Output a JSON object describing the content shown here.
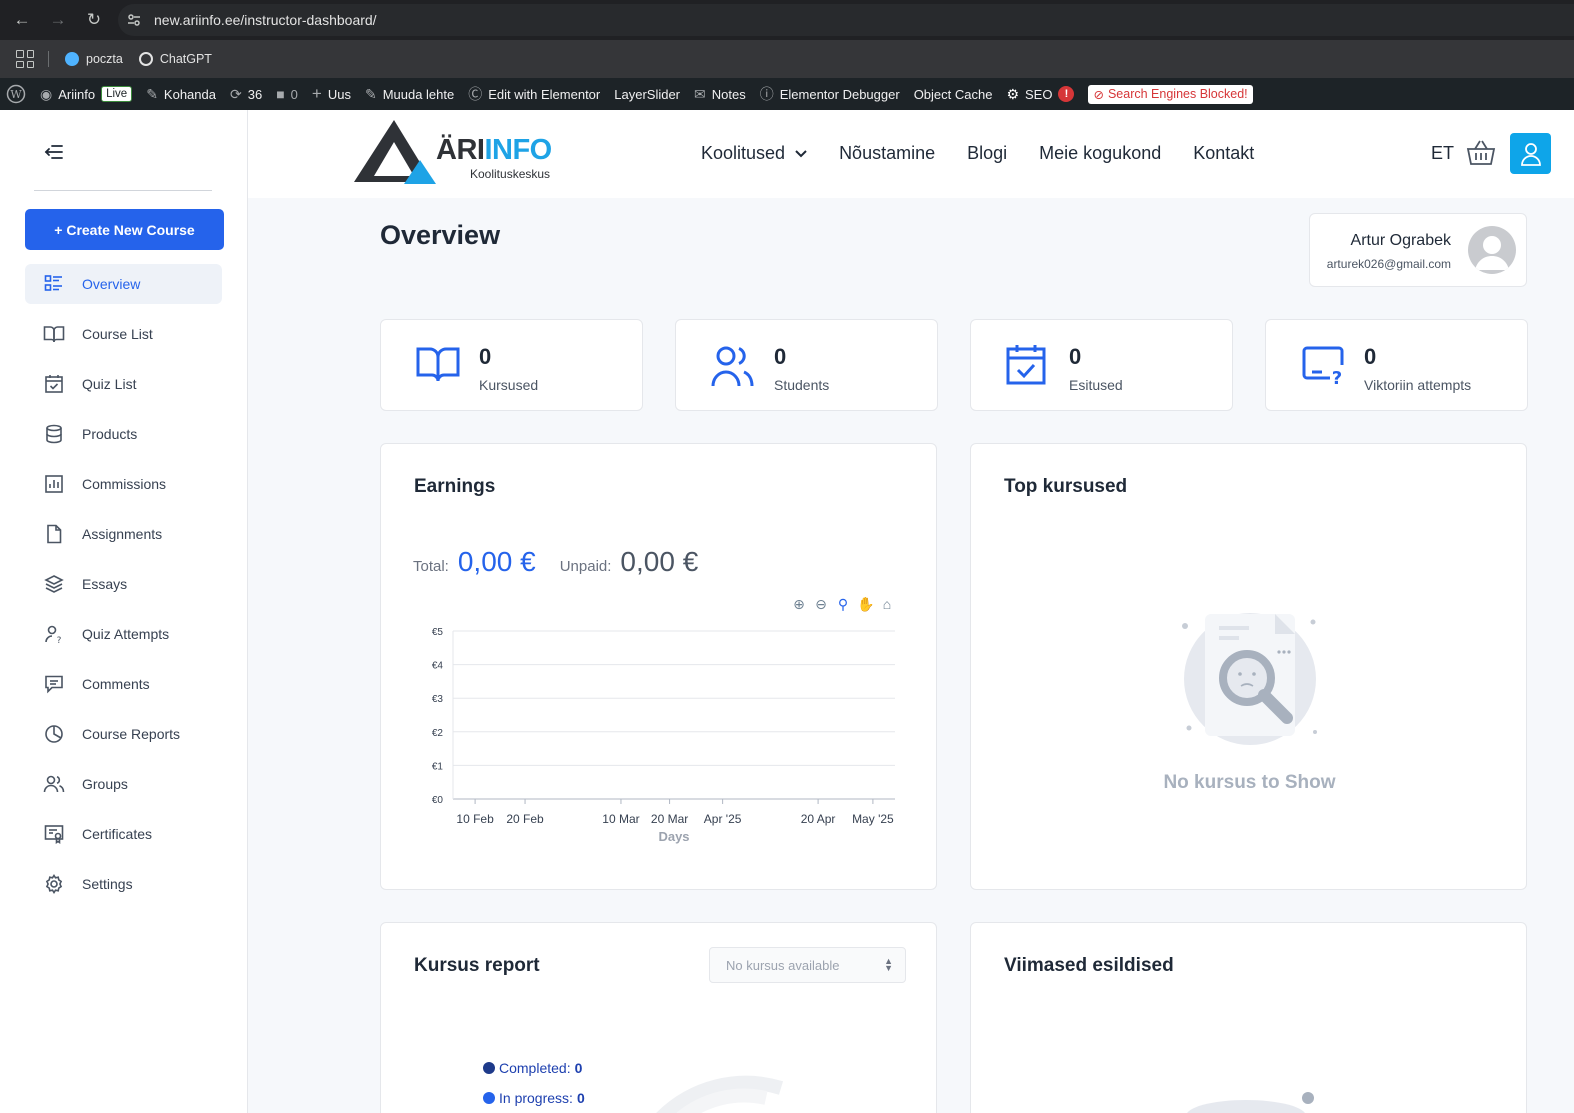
{
  "browser": {
    "url": "new.ariinfo.ee/instructor-dashboard/",
    "bookmarks": [
      {
        "label": "poczta"
      },
      {
        "label": "ChatGPT"
      }
    ]
  },
  "wpbar": {
    "site": "Ariinfo",
    "live": "Live",
    "customize": "Kohanda",
    "updates": "36",
    "comments": "0",
    "new": "Uus",
    "edit_page": "Muuda lehte",
    "elementor": "Edit with Elementor",
    "layerslider": "LayerSlider",
    "notes": "Notes",
    "debugger": "Elementor Debugger",
    "cache": "Object Cache",
    "seo": "SEO",
    "seo_alert": "!",
    "blocked": "Search Engines Blocked!"
  },
  "sidebar": {
    "create_label": "+ Create New Course",
    "items": [
      {
        "label": "Overview",
        "icon": "list-icon"
      },
      {
        "label": "Course List",
        "icon": "book-icon"
      },
      {
        "label": "Quiz List",
        "icon": "calendar-check-icon"
      },
      {
        "label": "Products",
        "icon": "database-icon"
      },
      {
        "label": "Commissions",
        "icon": "bar-chart-icon"
      },
      {
        "label": "Assignments",
        "icon": "file-icon"
      },
      {
        "label": "Essays",
        "icon": "layers-icon"
      },
      {
        "label": "Quiz Attempts",
        "icon": "user-question-icon"
      },
      {
        "label": "Comments",
        "icon": "comment-icon"
      },
      {
        "label": "Course Reports",
        "icon": "pie-icon"
      },
      {
        "label": "Groups",
        "icon": "users-icon"
      },
      {
        "label": "Certificates",
        "icon": "certificate-icon"
      },
      {
        "label": "Settings",
        "icon": "gear-icon"
      }
    ]
  },
  "header": {
    "logo_main": "ÄRI",
    "logo_accent": "INFO",
    "logo_sub": "Koolituskeskus",
    "nav": [
      {
        "label": "Koolitused"
      },
      {
        "label": "Nõustamine"
      },
      {
        "label": "Blogi"
      },
      {
        "label": "Meie kogukond"
      },
      {
        "label": "Kontakt"
      }
    ],
    "lang": "ET"
  },
  "main": {
    "title": "Overview",
    "profile": {
      "name": "Artur Ograbek",
      "email": "arturek026@gmail.com"
    },
    "stats": [
      {
        "value": "0",
        "label": "Kursused",
        "icon": "book-open-icon"
      },
      {
        "value": "0",
        "label": "Students",
        "icon": "users-icon"
      },
      {
        "value": "0",
        "label": "Esitused",
        "icon": "calendar-check-icon"
      },
      {
        "value": "0",
        "label": "Viktoriin attempts",
        "icon": "screen-question-icon"
      }
    ],
    "earnings": {
      "title": "Earnings",
      "total_label": "Total:",
      "total": "0,00 €",
      "unpaid_label": "Unpaid:",
      "unpaid": "0,00 €"
    },
    "top_courses": {
      "title": "Top kursused",
      "empty": "No kursus to Show"
    },
    "course_report": {
      "title": "Kursus report",
      "select_placeholder": "No kursus available",
      "completed_label": "Completed:",
      "completed": "0",
      "inprogress_label": "In progress:",
      "inprogress": "0"
    },
    "latest": {
      "title": "Viimased esildised"
    }
  },
  "chart_data": {
    "type": "line",
    "title": "",
    "xlabel": "Days",
    "ylabel": "",
    "y_ticks": [
      "€0",
      "€1",
      "€2",
      "€3",
      "€4",
      "€5"
    ],
    "ylim": [
      0,
      5
    ],
    "x_ticks": [
      "10 Feb",
      "20 Feb",
      "10 Mar",
      "20 Mar",
      "Apr '25",
      "20 Apr",
      "May '25"
    ],
    "series": [],
    "grid": true
  },
  "colors": {
    "accent": "#2563eb",
    "wpbar": "#1d2327",
    "blocked": "#d63638"
  }
}
